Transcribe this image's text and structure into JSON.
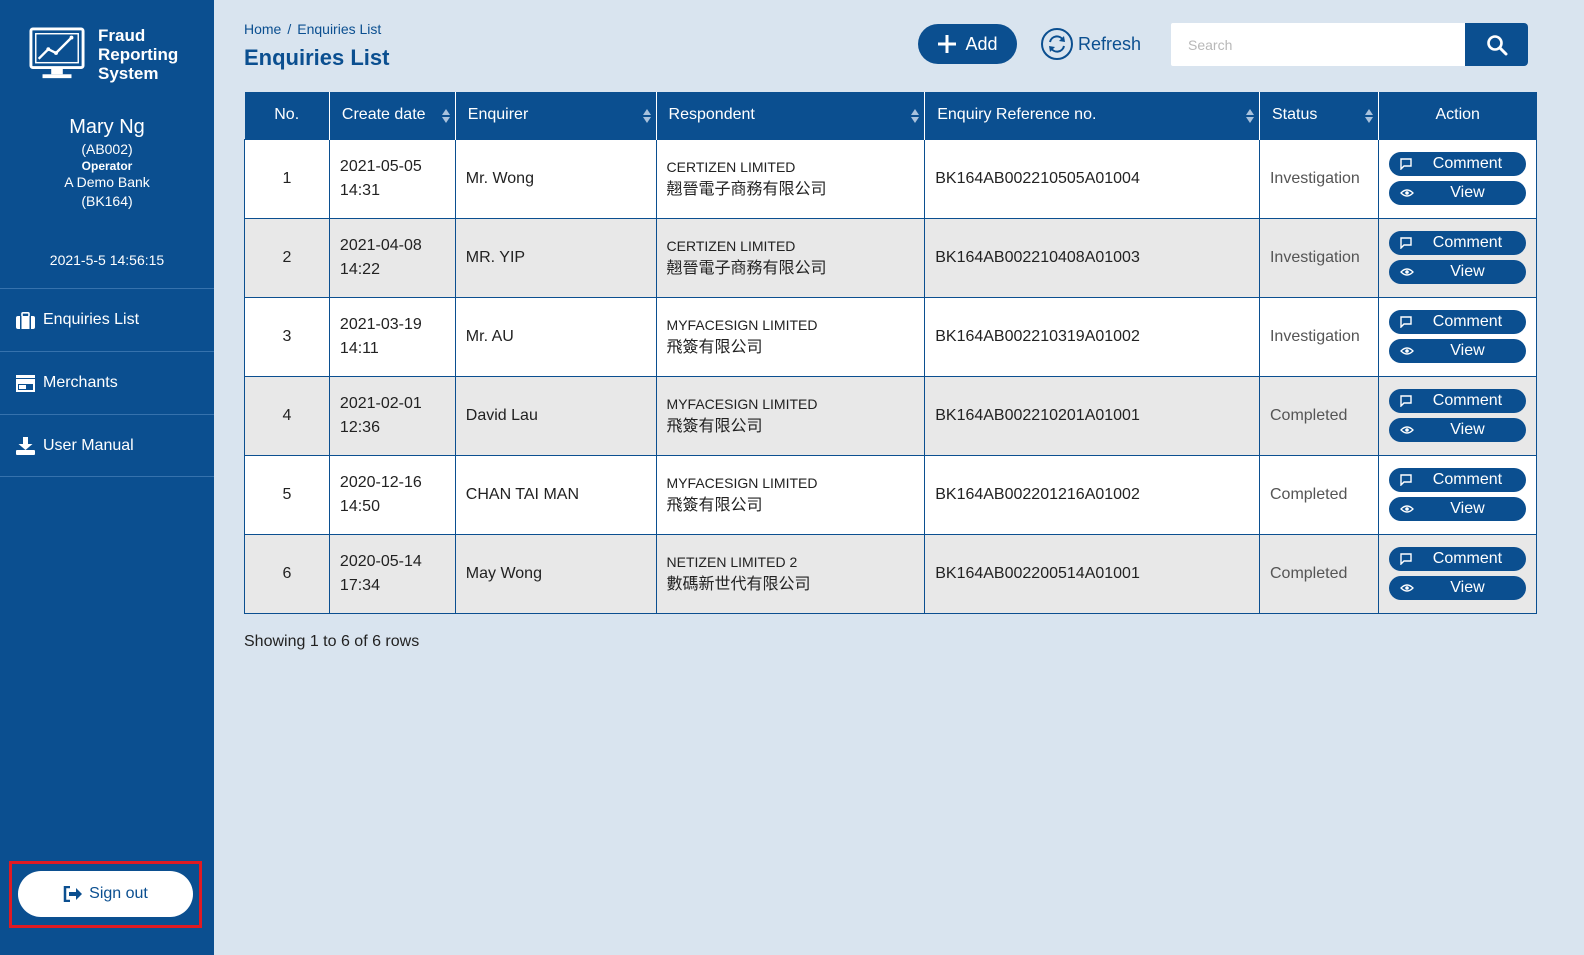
{
  "sidebar": {
    "logo_line1": "Fraud",
    "logo_line2": "Reporting",
    "logo_line3": "System",
    "user_name": "Mary Ng",
    "user_id": "(AB002)",
    "user_role": "Operator",
    "bank_name": "A Demo Bank",
    "bank_code": "(BK164)",
    "datetime": "2021-5-5 14:56:15",
    "nav": [
      {
        "label": "Enquiries List",
        "icon": "briefcase-icon"
      },
      {
        "label": "Merchants",
        "icon": "store-icon"
      },
      {
        "label": "User Manual",
        "icon": "download-icon"
      }
    ],
    "signout_label": "Sign out"
  },
  "header": {
    "breadcrumb": [
      "Home",
      "Enquiries List"
    ],
    "title": "Enquiries List",
    "add_label": "Add",
    "refresh_label": "Refresh",
    "search_placeholder": "Search"
  },
  "table": {
    "columns": [
      "No.",
      "Create date",
      "Enquirer",
      "Respondent",
      "Enquiry Reference no.",
      "Status",
      "Action"
    ],
    "comment_label": "Comment",
    "view_label": "View",
    "rows": [
      {
        "no": "1",
        "date": "2021-05-05",
        "time": "14:31",
        "enquirer": "Mr. Wong",
        "resp_en": "CERTIZEN LIMITED",
        "resp_zh": "翹晉電子商務有限公司",
        "ref": "BK164AB002210505A01004",
        "status": "Investigation"
      },
      {
        "no": "2",
        "date": "2021-04-08",
        "time": "14:22",
        "enquirer": "MR. YIP",
        "resp_en": "CERTIZEN LIMITED",
        "resp_zh": "翹晉電子商務有限公司",
        "ref": "BK164AB002210408A01003",
        "status": "Investigation"
      },
      {
        "no": "3",
        "date": "2021-03-19",
        "time": "14:11",
        "enquirer": "Mr. AU",
        "resp_en": "MYFACESIGN LIMITED",
        "resp_zh": "飛簽有限公司",
        "ref": "BK164AB002210319A01002",
        "status": "Investigation"
      },
      {
        "no": "4",
        "date": "2021-02-01",
        "time": "12:36",
        "enquirer": "David Lau",
        "resp_en": "MYFACESIGN LIMITED",
        "resp_zh": "飛簽有限公司",
        "ref": "BK164AB002210201A01001",
        "status": "Completed"
      },
      {
        "no": "5",
        "date": "2020-12-16",
        "time": "14:50",
        "enquirer": "CHAN TAI MAN",
        "resp_en": "MYFACESIGN LIMITED",
        "resp_zh": "飛簽有限公司",
        "ref": "BK164AB002201216A01002",
        "status": "Completed"
      },
      {
        "no": "6",
        "date": "2020-05-14",
        "time": "17:34",
        "enquirer": "May Wong",
        "resp_en": "NETIZEN LIMITED 2",
        "resp_zh": "數碼新世代有限公司",
        "ref": "BK164AB002200514A01001",
        "status": "Completed"
      }
    ],
    "rows_info": "Showing 1 to 6 of 6 rows"
  },
  "colors": {
    "primary": "#0b4f90",
    "background": "#d9e4ef",
    "highlight": "#e01a22"
  }
}
